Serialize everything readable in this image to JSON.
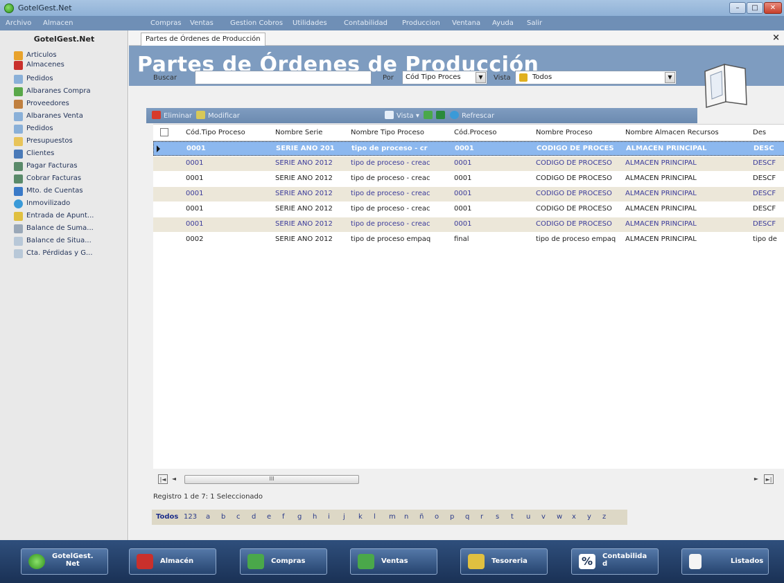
{
  "window": {
    "title": "GotelGest.Net",
    "min": "–",
    "max": "□",
    "close": "✕"
  },
  "menu": [
    "Archivo",
    "Almacen",
    "Compras",
    "Ventas",
    "Gestion Cobros",
    "Utilidades",
    "Contabilidad",
    "Produccion",
    "Ventana",
    "Ayuda",
    "Salir"
  ],
  "sidebar": {
    "title": "GotelGest.Net",
    "items": [
      "Articulos",
      "Almacenes",
      "Pedidos",
      "Albaranes Compra",
      "Proveedores",
      "Albaranes Venta",
      "Pedidos",
      "Presupuestos",
      "Clientes",
      "Pagar Facturas",
      "Cobrar Facturas",
      "Mto. de Cuentas",
      "Inmovilizado",
      "Entrada de Apunt...",
      "Balance de Suma...",
      "Balance de Situa...",
      "Cta. Pérdidas y G..."
    ]
  },
  "tab": {
    "label": "Partes de Órdenes de Producción",
    "close": "×"
  },
  "page": {
    "title": "Partes de Órdenes de Producción"
  },
  "filters": {
    "search_label": "Buscar",
    "search_value": "",
    "by_label": "Por",
    "by_value": "Cód Tipo Proces",
    "view_label": "Vista",
    "view_value": "Todos"
  },
  "toolbar": {
    "delete": "Eliminar",
    "modify": "Modificar",
    "view": "Vista",
    "refresh": "Refrescar"
  },
  "grid": {
    "columns": [
      "Cód.Tipo Proceso",
      "Nombre Serie",
      "Nombre Tipo Proceso",
      "Cód.Proceso",
      "Nombre Proceso",
      "Nombre Almacen Recursos",
      "Des"
    ],
    "rows": [
      [
        "0001",
        "SERIE AÑO 201",
        "tipo de proceso - cr",
        "0001",
        "CODIGO DE PROCES",
        "ALMACEN PRINCIPAL",
        "DESC"
      ],
      [
        "0001",
        "SERIE AÑO 2012",
        "tipo de proceso - creac",
        "0001",
        "CODIGO DE PROCESO",
        "ALMACEN PRINCIPAL",
        "DESCF"
      ],
      [
        "0001",
        "SERIE AÑO 2012",
        "tipo de proceso - creac",
        "0001",
        "CODIGO DE PROCESO",
        "ALMACEN PRINCIPAL",
        "DESCF"
      ],
      [
        "0001",
        "SERIE AÑO 2012",
        "tipo de proceso - creac",
        "0001",
        "CODIGO DE PROCESO",
        "ALMACEN PRINCIPAL",
        "DESCF"
      ],
      [
        "0001",
        "SERIE AÑO 2012",
        "tipo de proceso - creac",
        "0001",
        "CODIGO DE PROCESO",
        "ALMACEN PRINCIPAL",
        "DESCF"
      ],
      [
        "0001",
        "SERIE AÑO 2012",
        "tipo de proceso - creac",
        "0001",
        "CODIGO DE PROCESO",
        "ALMACEN PRINCIPAL",
        "DESCF"
      ],
      [
        "0002",
        "SERIE AÑO 2012",
        "tipo de proceso empaq",
        "final",
        "tipo de proceso empaq",
        "ALMACEN PRINCIPAL",
        "tipo de"
      ]
    ],
    "selected_row": 0
  },
  "status": "Registro 1 de 7: 1 Seleccionado",
  "alphabet": [
    "Todos",
    "123",
    "a",
    "b",
    "c",
    "d",
    "e",
    "f",
    "g",
    "h",
    "i",
    "j",
    "k",
    "l",
    "m",
    "n",
    "ñ",
    "o",
    "p",
    "q",
    "r",
    "s",
    "t",
    "u",
    "v",
    "w",
    "x",
    "y",
    "z"
  ],
  "scroll": {
    "thumb": "III",
    "first": "|◄",
    "prev": "◄",
    "next": "►",
    "last": "►|"
  },
  "bottom": [
    "GotelGest.\nNet",
    "Almacén",
    "Compras",
    "Ventas",
    "Tesoreria",
    "Contabilida\nd",
    "Listados"
  ],
  "colors": {
    "accent": "#7e9cc0",
    "selected_row": "#8cb8ef",
    "alt_row": "#ece7d9",
    "bottom_bar": "#1a3155"
  }
}
